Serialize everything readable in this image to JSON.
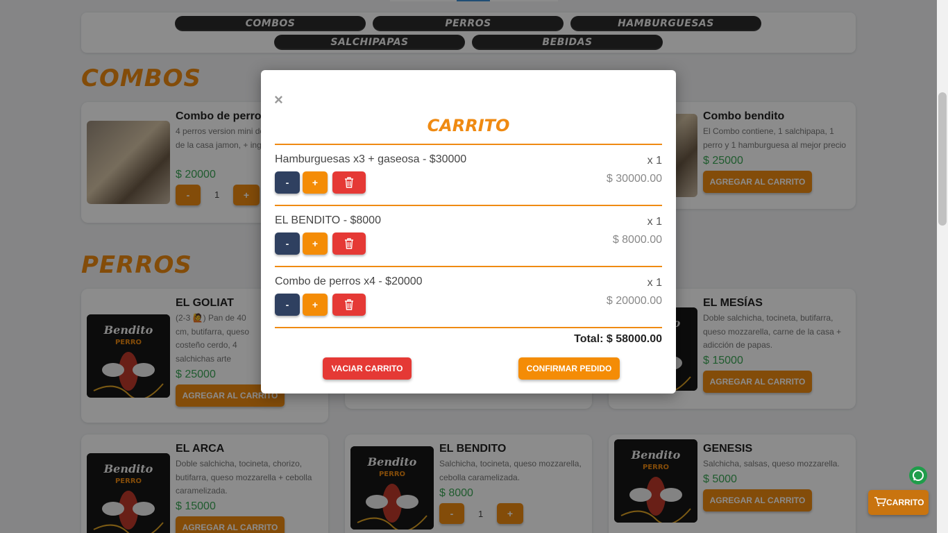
{
  "nav": {
    "categories": [
      "COMBOS",
      "PERROS",
      "HAMBURGUESAS",
      "SALCHIPAPAS",
      "BEBIDAS"
    ]
  },
  "sections": {
    "combos_title": "COMBOS",
    "perros_title": "PERROS"
  },
  "cards": {
    "combo_perros": {
      "name": "Combo de perros",
      "desc": "4 perros version mini de sabores: carne de la casa jamon, + ingredientes d",
      "price": "$ 20000",
      "qty": "1"
    },
    "combo_bendito": {
      "name": "Combo bendito",
      "desc": "El Combo contiene, 1 salchipapa, 1 perro y 1 hamburguesa al mejor precio",
      "price": "$ 25000",
      "add": "AGREGAR AL CARRITO"
    },
    "goliat": {
      "name": "EL GOLIAT",
      "desc": "(2-3 🙋) Pan de 40 cm, butifarra, queso costeño cerdo, 4 salchichas arte caramelizada, salsas.",
      "price": "$ 25000",
      "add": "AGREGAR AL CARRITO"
    },
    "mesias": {
      "name": "EL MESÍAS",
      "desc": "Doble salchicha, tocineta, butifarra, queso mozzarella, carne de la casa + adicción de papas.",
      "price": "$ 15000",
      "add": "AGREGAR AL CARRITO"
    },
    "arca": {
      "name": "EL ARCA",
      "desc": "Doble salchicha, tocineta, chorizo, butifarra, queso mozzarella + cebolla caramelizada.",
      "price": "$ 15000",
      "add": "AGREGAR AL CARRITO"
    },
    "bendito": {
      "name": "EL BENDITO",
      "desc": "Salchicha, tocineta, queso mozzarella, cebolla caramelizada.",
      "price": "$ 8000",
      "qty": "1"
    },
    "genesis": {
      "name": "GENESIS",
      "desc": "Salchicha, salsas, queso mozzarella.",
      "price": "$ 5000",
      "add": "AGREGAR AL CARRITO"
    }
  },
  "buttons": {
    "minus": "-",
    "plus": "+"
  },
  "modal": {
    "close": "×",
    "title": "CARRITO",
    "items": [
      {
        "name": "Hamburguesas x3 + gaseosa - $30000",
        "qty": "x 1",
        "subtotal": "$ 30000.00"
      },
      {
        "name": "EL BENDITO - $8000",
        "qty": "x 1",
        "subtotal": "$ 8000.00"
      },
      {
        "name": "Combo de perros x4 - $20000",
        "qty": "x 1",
        "subtotal": "$ 20000.00"
      }
    ],
    "total": "Total: $ 58000.00",
    "clear": "VACIAR CARRITO",
    "confirm": "CONFIRMAR PEDIDO"
  },
  "floating_cart": "CARRITO",
  "logo_text": "Bendito PERRO",
  "colors": {
    "accent": "#ef8a12",
    "price": "#3aa655",
    "danger": "#e53935",
    "navy": "#2f4060"
  }
}
